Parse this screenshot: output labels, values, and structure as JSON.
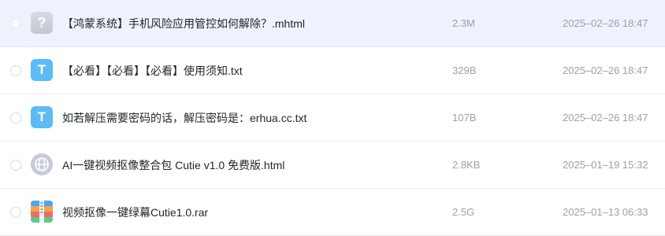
{
  "files": [
    {
      "name": "【鸿蒙系统】手机风险应用管控如何解除？.mhtml",
      "size": "2.3M",
      "date": "2025–02–26 18:47",
      "icon": "unknown-file-icon",
      "icon_glyph": "?"
    },
    {
      "name": "【必看】【必看】【必看】使用须知.txt",
      "size": "329B",
      "date": "2025–02–26 18:47",
      "icon": "text-file-icon",
      "icon_glyph": "T"
    },
    {
      "name": "如若解压需要密码的话，解压密码是：erhua.cc.txt",
      "size": "107B",
      "date": "2025–02–26 18:47",
      "icon": "text-file-icon",
      "icon_glyph": "T"
    },
    {
      "name": "AI一键视频抠像整合包 Cutie v1.0 免费版.html",
      "size": "2.8KB",
      "date": "2025–01–19 15:32",
      "icon": "web-file-icon"
    },
    {
      "name": "视频抠像一键绿幕Cutie1.0.rar",
      "size": "2.5G",
      "date": "2025–01–13 06:33",
      "icon": "archive-file-icon"
    }
  ],
  "colors": {
    "selected_row": "#eef2fd",
    "text_icon": "#5bbcf4",
    "meta_text": "#9aa0ab"
  }
}
